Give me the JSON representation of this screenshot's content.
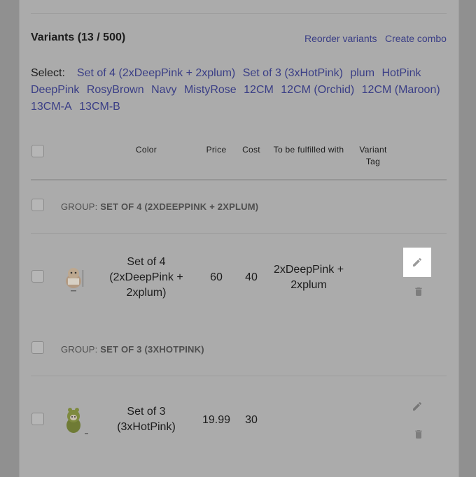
{
  "section": {
    "title": "Variants (13 / 500)",
    "reorder_label": "Reorder variants",
    "combo_label": "Create combo"
  },
  "select": {
    "label": "Select:",
    "options": [
      "Set of 4 (2xDeepPink + 2xplum)",
      "Set of 3 (3xHotPink)",
      "plum",
      "HotPink",
      "DeepPink",
      "RosyBrown",
      "Navy",
      "MistyRose",
      "12CM",
      "12CM (Orchid)",
      "12CM (Maroon)",
      "13CM-A",
      "13CM-B"
    ]
  },
  "table": {
    "headers": {
      "color": "Color",
      "price": "Price",
      "cost": "Cost",
      "fulfilled": "To be fulfilled with",
      "tag_line1": "Variant",
      "tag_line2": "Tag"
    },
    "groups": [
      {
        "prefix": "GROUP:",
        "name": "SET OF 4 (2XDEEPPINK + 2XPLUM)",
        "variant": {
          "color_lines": [
            "Set of 4",
            "(2xDeepPink +",
            "2xplum)"
          ],
          "price": "60",
          "cost": "40",
          "fulfilled_lines": [
            "2xDeepPink +",
            "2xplum"
          ]
        }
      },
      {
        "prefix": "GROUP:",
        "name": "SET OF 3 (3XHOTPINK)",
        "variant": {
          "color_lines": [
            "Set of 3",
            "(3xHotPink)"
          ],
          "price": "19.99",
          "cost": "30",
          "fulfilled_lines": []
        }
      }
    ]
  },
  "colors": {
    "overlay_bg": "#909090",
    "card_bg": "#ababab",
    "link": "#3a3e86",
    "highlight": "#ffffff"
  }
}
